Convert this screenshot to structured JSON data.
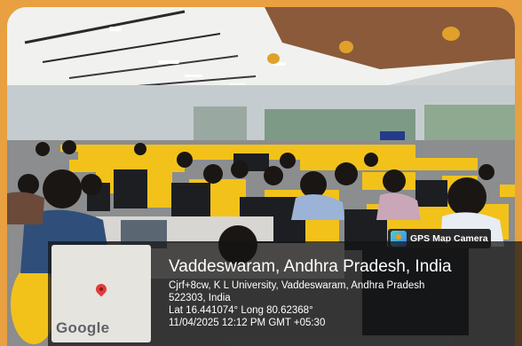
{
  "gps_camera": {
    "app_label": "GPS Map Camera",
    "map_brand": "Google",
    "place_title": "Vaddeswaram, Andhra Pradesh, India",
    "address_lines": [
      "Cjrf+8cw, K L University, Vaddeswaram, Andhra Pradesh",
      "522303, India"
    ],
    "coordinates": "Lat 16.441074° Long 80.62368°",
    "datetime": "11/04/2025 12:12 PM GMT +05:30"
  },
  "icons": {
    "camera": "gps-camera-icon",
    "map_pin": "map-pin-icon"
  },
  "colors": {
    "frame": "#e8a040",
    "partition": "#f2c21b",
    "overlay": "#141414",
    "pin": "#e23b3b"
  }
}
